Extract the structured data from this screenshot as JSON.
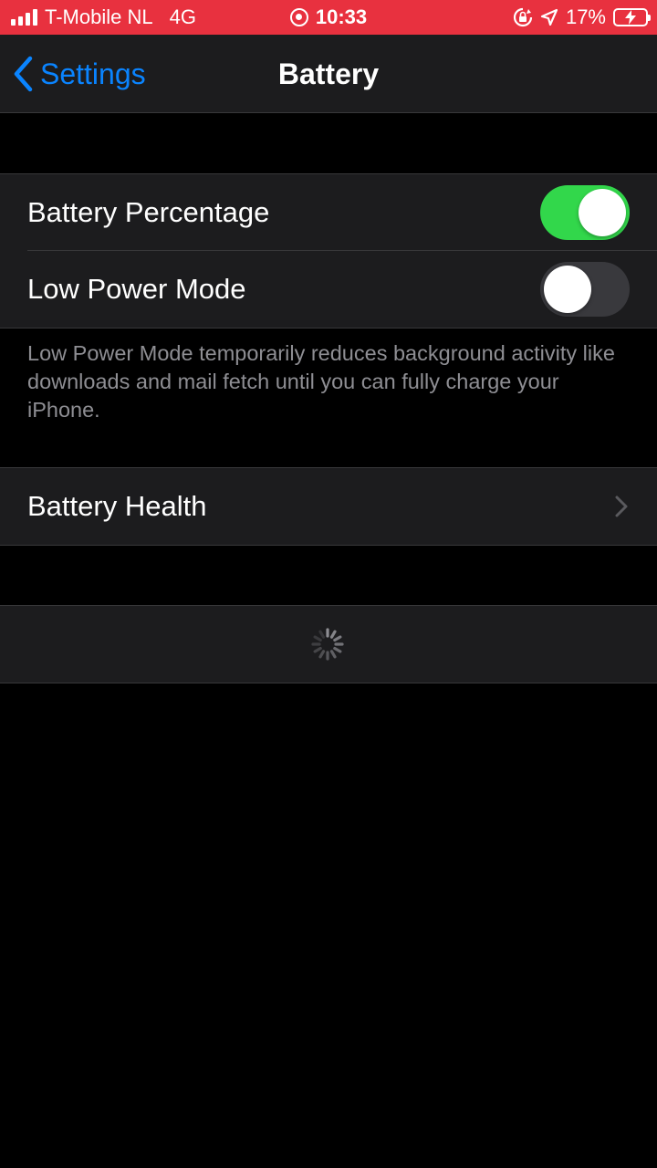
{
  "status_bar": {
    "carrier": "T-Mobile NL",
    "network": "4G",
    "time": "10:33",
    "battery_percent": "17%",
    "background_color": "#e8313f"
  },
  "nav": {
    "back_label": "Settings",
    "title": "Battery"
  },
  "settings": {
    "battery_percentage": {
      "label": "Battery Percentage",
      "enabled": true
    },
    "low_power_mode": {
      "label": "Low Power Mode",
      "enabled": false
    },
    "low_power_footnote": "Low Power Mode temporarily reduces background activity like downloads and mail fetch until you can fully charge your iPhone.",
    "battery_health": {
      "label": "Battery Health"
    }
  },
  "colors": {
    "accent": "#0a84ff",
    "toggle_on": "#32d74b",
    "cell_background": "#1c1c1e",
    "footnote_text": "#8e8e93"
  },
  "icons": [
    "signal-icon",
    "screen-record-icon",
    "orientation-lock-icon",
    "location-icon",
    "battery-charging-icon",
    "back-chevron-icon",
    "chevron-right-icon",
    "loading-spinner-icon"
  ]
}
